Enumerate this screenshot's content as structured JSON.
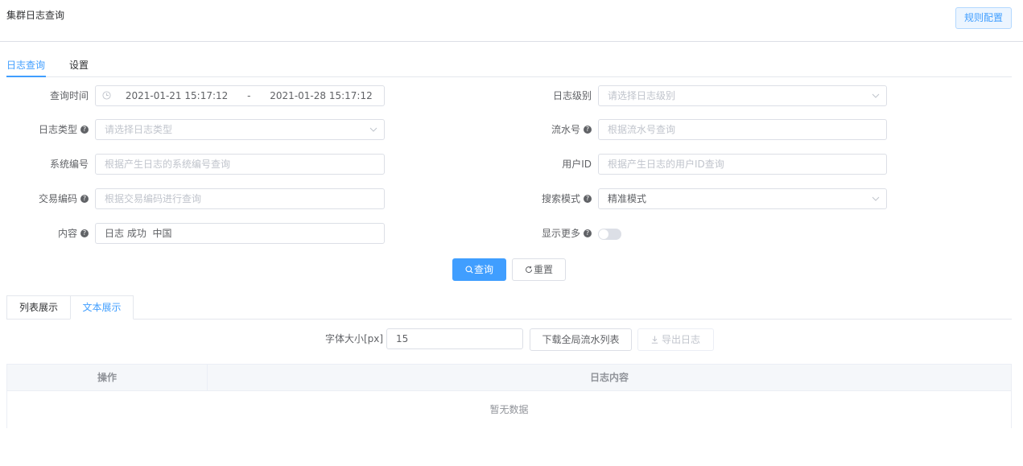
{
  "page_title": "集群日志查询",
  "rule_config_label": "规则配置",
  "tabs": [
    {
      "label": "日志查询",
      "active": true
    },
    {
      "label": "设置",
      "active": false
    }
  ],
  "form": {
    "query_time": {
      "label": "查询时间",
      "start": "2021-01-21 15:17:12",
      "separator": "-",
      "end": "2021-01-28 15:17:12"
    },
    "log_level": {
      "label": "日志级别",
      "placeholder": "请选择日志级别"
    },
    "log_type": {
      "label": "日志类型",
      "placeholder": "请选择日志类型"
    },
    "serial_no": {
      "label": "流水号",
      "placeholder": "根据流水号查询"
    },
    "system_code": {
      "label": "系统编号",
      "placeholder": "根据产生日志的系统编号查询"
    },
    "user_id": {
      "label": "用户ID",
      "placeholder": "根据产生日志的用户ID查询"
    },
    "trade_code": {
      "label": "交易编码",
      "placeholder": "根据交易编码进行查询"
    },
    "search_mode": {
      "label": "搜索模式",
      "value": "精准模式"
    },
    "content": {
      "label": "内容",
      "value": "日志 成功  中国"
    },
    "show_more": {
      "label": "显示更多",
      "on": false
    }
  },
  "actions": {
    "query": "查询",
    "reset": "重置"
  },
  "view_tabs": [
    {
      "label": "列表展示",
      "active": false
    },
    {
      "label": "文本展示",
      "active": true
    }
  ],
  "font_size": {
    "label": "字体大小[px]",
    "value": "15"
  },
  "download_label": "下载全局流水列表",
  "export_label": "导出日志",
  "table": {
    "columns": [
      "操作",
      "日志内容"
    ],
    "empty_text": "暂无数据"
  },
  "colors": {
    "accent": "#409eff",
    "border": "#dcdfe6",
    "placeholder": "#c0c4cc"
  }
}
